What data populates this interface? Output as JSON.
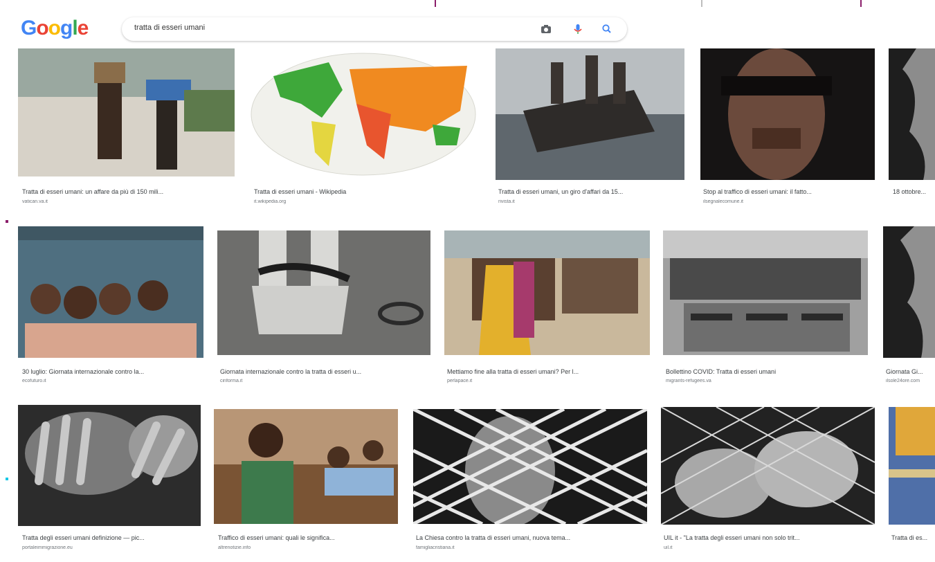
{
  "logo": {
    "letters": [
      "G",
      "o",
      "o",
      "g",
      "l",
      "e"
    ],
    "colors": [
      "#4285f4",
      "#ea4335",
      "#fbbc05",
      "#4285f4",
      "#34a853",
      "#ea4335"
    ]
  },
  "search": {
    "query": "tratta di esseri umani"
  },
  "icons": {
    "camera": "camera-icon",
    "mic": "microphone-icon",
    "search": "search-icon"
  },
  "results": [
    {
      "title": "Tratta di esseri umani: un affare da più di 150 mili...",
      "source": "vatican.va.it"
    },
    {
      "title": "Tratta di esseri umani - Wikipedia",
      "source": "it.wikipedia.org"
    },
    {
      "title": "Tratta di esseri umani, un giro d'affari da 15...",
      "source": "rivista.it"
    },
    {
      "title": "Stop al traffico di esseri umani: il fatto...",
      "source": "ilsegnalecomune.it"
    },
    {
      "title": "18 ottobre...",
      "source": ""
    },
    {
      "title": "30 luglio: Giornata internazionale contro la...",
      "source": "ecofuturo.it"
    },
    {
      "title": "Giornata internazionale contro la tratta di esseri u...",
      "source": "cinforma.it"
    },
    {
      "title": "Mettiamo fine alla tratta di esseri umani? Per l...",
      "source": "perlapace.it"
    },
    {
      "title": "Bollettino COVID: Tratta di esseri umani",
      "source": "migrants-refugees.va"
    },
    {
      "title": "Giornata Gi...",
      "source": "ilsole24ore.com"
    },
    {
      "title": "Tratta degli esseri umani definizione — pic...",
      "source": "portaleimmigrazione.eu"
    },
    {
      "title": "Traffico di esseri umani: quali le significa...",
      "source": "altrenotizie.info"
    },
    {
      "title": "La Chiesa contro la tratta di esseri umani, nuova tema...",
      "source": "famigliacristiana.it"
    },
    {
      "title": "UIL it - \"La tratta degli esseri umani non solo trit...",
      "source": "uil.it"
    },
    {
      "title": "Tratta di es...",
      "source": ""
    }
  ]
}
